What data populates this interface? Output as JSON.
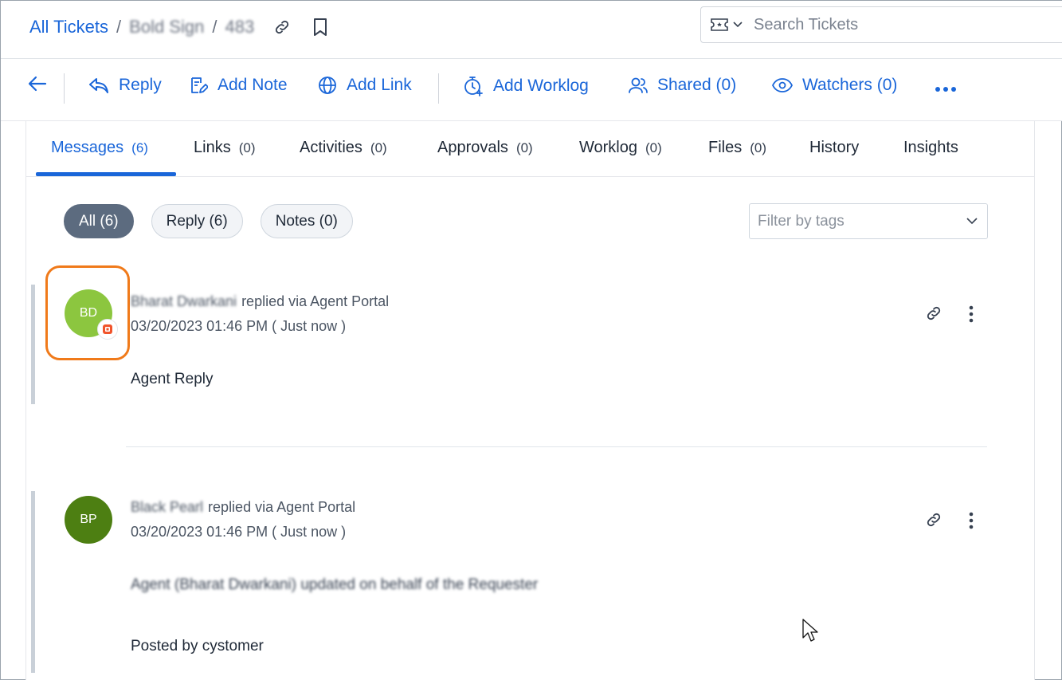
{
  "breadcrumb": {
    "root": "All Tickets",
    "project": "Bold Sign",
    "ticket_id": "483",
    "separator": "/"
  },
  "search": {
    "placeholder": "Search Tickets"
  },
  "toolbar": {
    "reply": "Reply",
    "add_note": "Add Note",
    "add_link": "Add Link",
    "add_worklog": "Add Worklog",
    "shared": "Shared (0)",
    "watchers": "Watchers (0)"
  },
  "tabs": [
    {
      "label": "Messages",
      "count": "(6)"
    },
    {
      "label": "Links",
      "count": "(0)"
    },
    {
      "label": "Activities",
      "count": "(0)"
    },
    {
      "label": "Approvals",
      "count": "(0)"
    },
    {
      "label": "Worklog",
      "count": "(0)"
    },
    {
      "label": "Files",
      "count": "(0)"
    },
    {
      "label": "History",
      "count": ""
    },
    {
      "label": "Insights",
      "count": ""
    }
  ],
  "filters": {
    "all": "All (6)",
    "reply": "Reply (6)",
    "notes": "Notes (0)",
    "tag_placeholder": "Filter by tags"
  },
  "messages": [
    {
      "initials": "BD",
      "author": "Bharat Dwarkani",
      "action": "replied via Agent Portal",
      "date": "03/20/2023 01:46 PM ( Just now )",
      "body": "Agent Reply",
      "avatar_color": "#8cc63f"
    },
    {
      "initials": "BP",
      "author": "Black Pearl",
      "action": "replied via Agent Portal",
      "date": "03/20/2023 01:46 PM ( Just now )",
      "body_note": "Agent (Bharat Dwarkani) updated on behalf of the Requester",
      "body": "Posted by cystomer",
      "avatar_color": "#4d7f12"
    }
  ],
  "colors": {
    "accent": "#1a66d9",
    "highlight": "#f07a1a",
    "chip_active": "#5c6b7f"
  }
}
